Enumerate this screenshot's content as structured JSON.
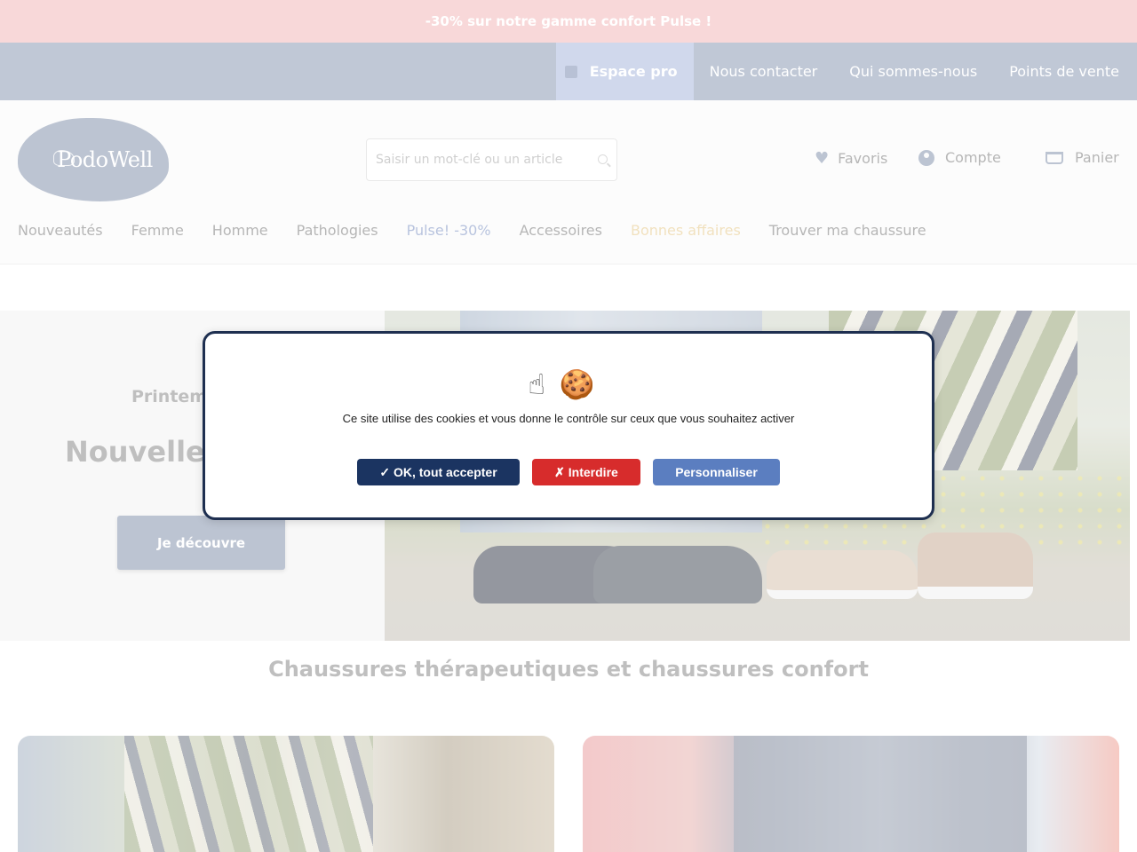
{
  "promo": {
    "text": "-30% sur notre gamme confort Pulse !"
  },
  "top_nav": {
    "items": [
      {
        "label": "Espace pro",
        "icon": "door-icon"
      },
      {
        "label": "Nous contacter"
      },
      {
        "label": "Qui sommes-nous"
      },
      {
        "label": "Points de vente"
      }
    ]
  },
  "header": {
    "logo_text": "PodoWell",
    "search": {
      "placeholder": "Saisir un mot-clé ou un article"
    },
    "utilities": {
      "favorites": "Favoris",
      "account": "Compte",
      "cart": "Panier"
    }
  },
  "main_nav": {
    "items": [
      "Nouveautés",
      "Femme",
      "Homme",
      "Pathologies",
      "Pulse! -30%",
      "Accessoires",
      "Bonnes affaires",
      "Trouver ma chaussure"
    ]
  },
  "hero": {
    "subtitle": "Printem",
    "title": "Nouvelle c",
    "cta": "Je découvre"
  },
  "section": {
    "title": "Chaussures thérapeutiques et chaussures confort"
  },
  "cookie_modal": {
    "icons": [
      "☝",
      "🍪"
    ],
    "message": "Ce site utilise des cookies et vous donne le contrôle sur ceux que vous souhaitez activer",
    "accept_label": "✓ OK, tout accepter",
    "deny_label": "✗ Interdire",
    "customize_label": "Personnaliser"
  },
  "colors": {
    "promo_bg": "#f3b9bb",
    "nav_bg": "#8d9bb5",
    "brand": "#8694ad",
    "pulse": "#7e93c3",
    "deals": "#e6c889",
    "accept": "#1b3461",
    "deny": "#d72c2c",
    "customize": "#5b7ec0"
  }
}
